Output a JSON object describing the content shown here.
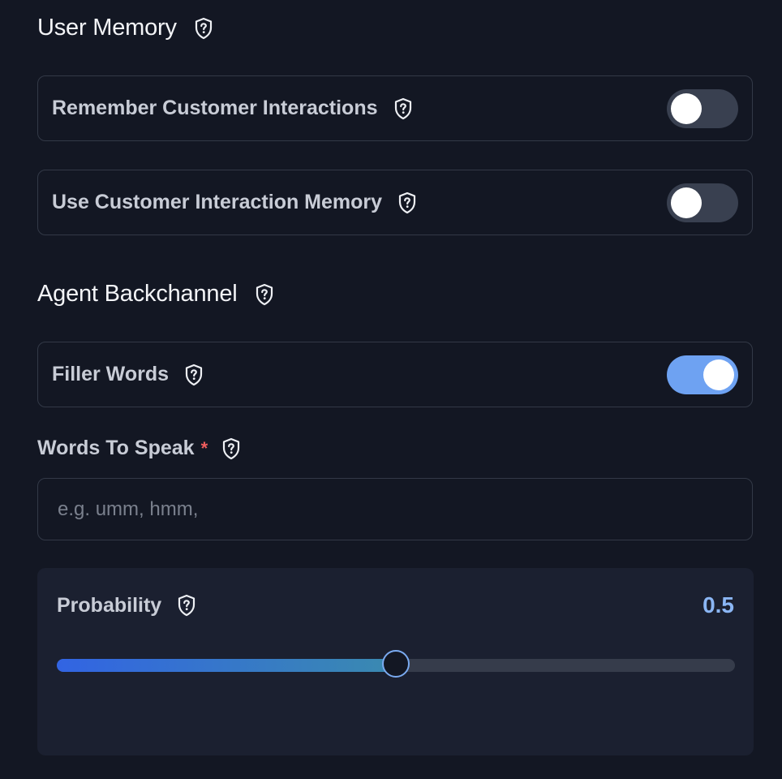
{
  "user_memory": {
    "title": "User Memory",
    "settings": [
      {
        "label": "Remember Customer Interactions",
        "enabled": false
      },
      {
        "label": "Use Customer Interaction Memory",
        "enabled": false
      }
    ]
  },
  "agent_backchannel": {
    "title": "Agent Backchannel",
    "filler_words": {
      "label": "Filler Words",
      "enabled": true
    },
    "words_to_speak": {
      "label": "Words To Speak",
      "required_mark": "*",
      "value": "",
      "placeholder": "e.g. umm, hmm,"
    },
    "probability": {
      "label": "Probability",
      "value": "0.5",
      "fraction": 0.5
    }
  },
  "icons": {
    "help": "shield-question-icon"
  },
  "colors": {
    "background": "#131723",
    "accent": "#6ea2f2",
    "value_text": "#8bb6f4",
    "required": "#ef5d5d"
  }
}
